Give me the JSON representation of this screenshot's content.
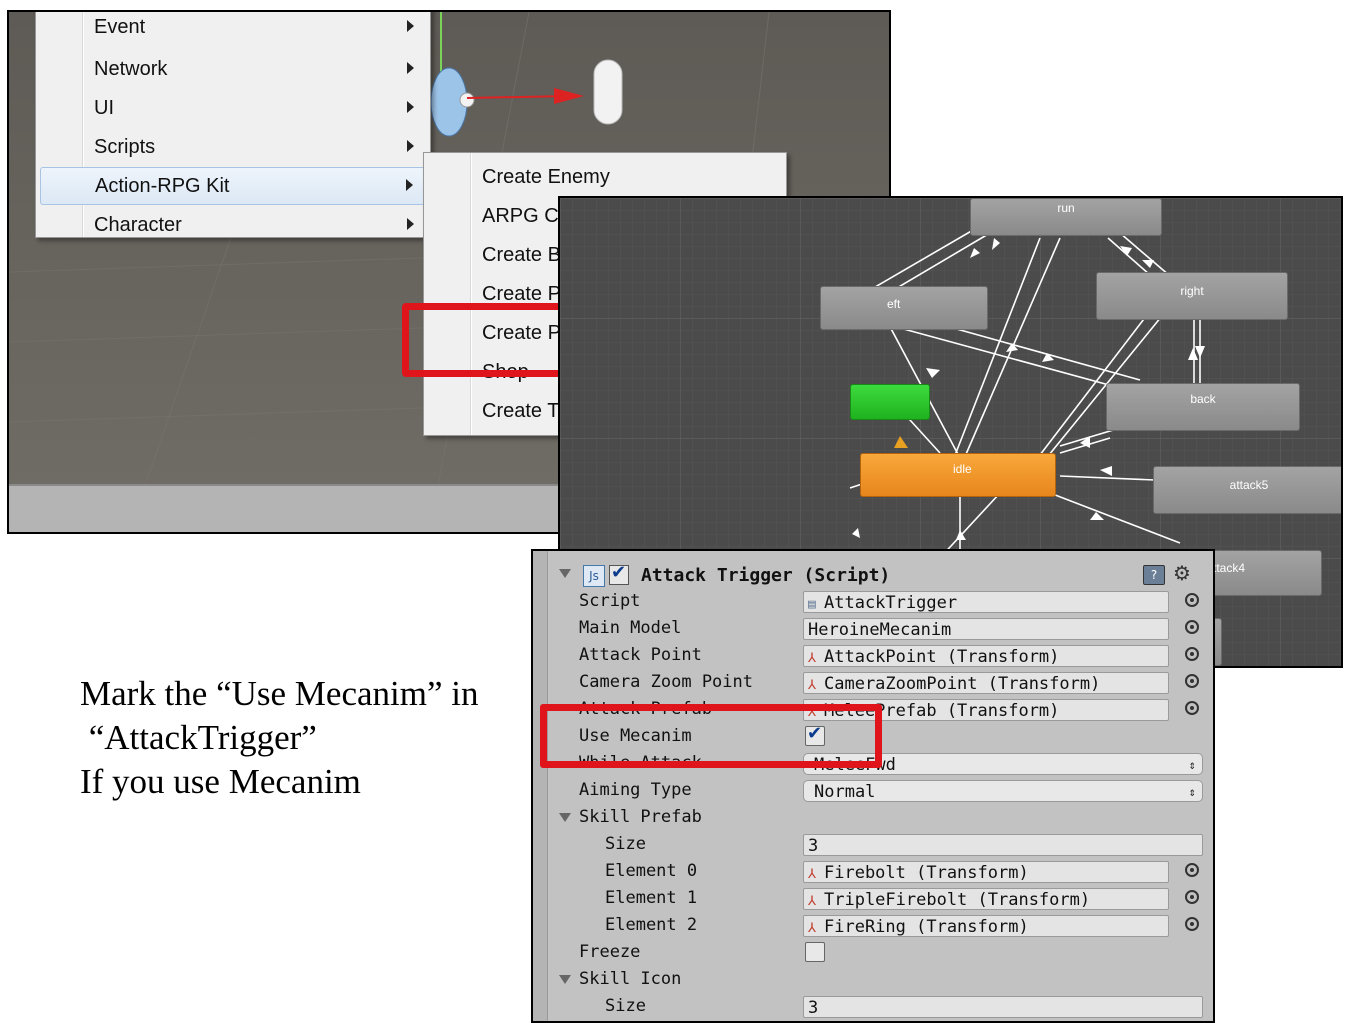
{
  "context_menu": {
    "items": [
      {
        "label": "Event",
        "submenu": true
      },
      {
        "label": "Network",
        "submenu": true
      },
      {
        "label": "UI",
        "submenu": true
      },
      {
        "label": "Scripts",
        "submenu": true
      },
      {
        "label": "Action-RPG Kit",
        "submenu": true,
        "selected": true
      },
      {
        "label": "Character",
        "submenu": true
      }
    ]
  },
  "submenu": {
    "items": [
      {
        "label": "Create Enemy"
      },
      {
        "label": "ARPG Camera"
      },
      {
        "label": "Create Bullet"
      },
      {
        "label": "Create Player(Legacy)"
      },
      {
        "label": "Create Player(Mecanim)",
        "highlighted": true
      },
      {
        "label": "Shop"
      },
      {
        "label": "Create Teleporter"
      }
    ]
  },
  "animator": {
    "states": [
      "run",
      "eft",
      "right",
      "back",
      "idle",
      "attack5",
      "ttack4"
    ]
  },
  "caption": {
    "line1": "Mark the “Use Mecanim” in",
    "line2": " “AttackTrigger”",
    "line3": "If you use Mecanim"
  },
  "inspector": {
    "component_title": "Attack Trigger (Script)",
    "script_badge": "Js",
    "rows": {
      "script": {
        "label": "Script",
        "value": "AttackTrigger"
      },
      "main_model": {
        "label": "Main Model",
        "value": "HeroineMecanim"
      },
      "attack_point": {
        "label": "Attack Point",
        "value": "AttackPoint (Transform)"
      },
      "camera_zoom_point": {
        "label": "Camera Zoom Point",
        "value": "CameraZoomPoint (Transform)"
      },
      "attack_prefab": {
        "label": "Attack Prefab",
        "value": "MeleePrefab (Transform)"
      },
      "use_mecanim": {
        "label": "Use Mecanim",
        "checked": true
      },
      "while_attack": {
        "label": "While Attack",
        "value": "MeleeFwd"
      },
      "aiming_type": {
        "label": "Aiming Type",
        "value": "Normal"
      },
      "skill_prefab": {
        "label": "Skill Prefab"
      },
      "skill_prefab_size": {
        "label": "Size",
        "value": "3"
      },
      "element0": {
        "label": "Element 0",
        "value": "Firebolt (Transform)"
      },
      "element1": {
        "label": "Element 1",
        "value": "TripleFirebolt (Transform)"
      },
      "element2": {
        "label": "Element 2",
        "value": "FireRing (Transform)"
      },
      "freeze": {
        "label": "Freeze",
        "checked": false
      },
      "skill_icon": {
        "label": "Skill Icon"
      },
      "skill_icon_size": {
        "label": "Size",
        "value": "3"
      }
    }
  },
  "colors": {
    "highlight": "#e0141b",
    "idle_state": "#f29a2e",
    "entry_state": "#22c022"
  }
}
